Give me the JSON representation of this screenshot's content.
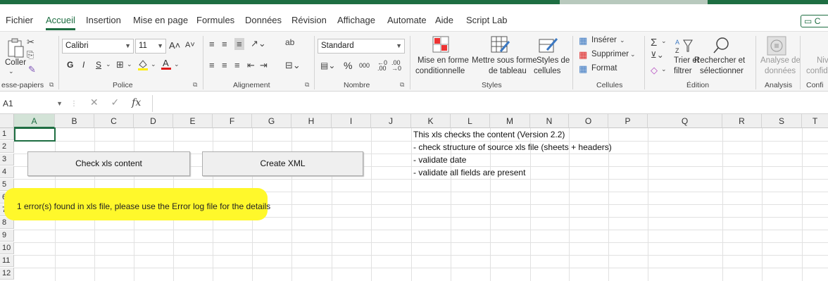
{
  "menu_tabs": [
    "Fichier",
    "Accueil",
    "Insertion",
    "Mise en page",
    "Formules",
    "Données",
    "Révision",
    "Affichage",
    "Automate",
    "Aide",
    "Script Lab"
  ],
  "share_label": "C",
  "clipboard": {
    "paste": "Coller",
    "group": "esse-papiers"
  },
  "font": {
    "name": "Calibri",
    "size": "11",
    "bold": "G",
    "italic": "I",
    "underline": "S",
    "group": "Police"
  },
  "alignment": {
    "group": "Alignement"
  },
  "number": {
    "format": "Standard",
    "percent": "%",
    "thousands": "000",
    "group": "Nombre"
  },
  "styles": {
    "conditional": [
      "Mise en forme",
      "conditionnelle"
    ],
    "table": [
      "Mettre sous forme",
      "de tableau"
    ],
    "cell": [
      "Styles de",
      "cellules"
    ],
    "group": "Styles"
  },
  "cells": {
    "insert": "Insérer",
    "delete": "Supprimer",
    "format": "Format",
    "group": "Cellules"
  },
  "editing": {
    "sort": [
      "Trier et",
      "filtrer"
    ],
    "find": [
      "Rechercher et",
      "sélectionner"
    ],
    "group": "Édition"
  },
  "analysis": {
    "label": [
      "Analyse de",
      "données"
    ],
    "group": "Analysis"
  },
  "confid": {
    "label": [
      "Niv",
      "confid"
    ],
    "group": "Confi"
  },
  "name_box": "A1",
  "fx_label": "fx",
  "columns": [
    "A",
    "B",
    "C",
    "D",
    "E",
    "F",
    "G",
    "H",
    "I",
    "J",
    "K",
    "L",
    "M",
    "N",
    "O",
    "P",
    "Q",
    "R",
    "S",
    "T"
  ],
  "rows": [
    "1",
    "2",
    "3",
    "4",
    "5",
    "6",
    "7",
    "8",
    "9",
    "10",
    "11",
    "12"
  ],
  "buttons": {
    "check": "Check xls content",
    "create": "Create XML"
  },
  "info_lines": [
    "This xls checks the content (Version 2.2)",
    "- check structure of source xls file  (sheets + headers)",
    "- validate date",
    "- validate all fields are present"
  ],
  "error_message": "1 error(s) found in xls file, please use the Error log file for the details",
  "colors": {
    "accent": "#1e6e42",
    "highlight": "#fff82b"
  }
}
